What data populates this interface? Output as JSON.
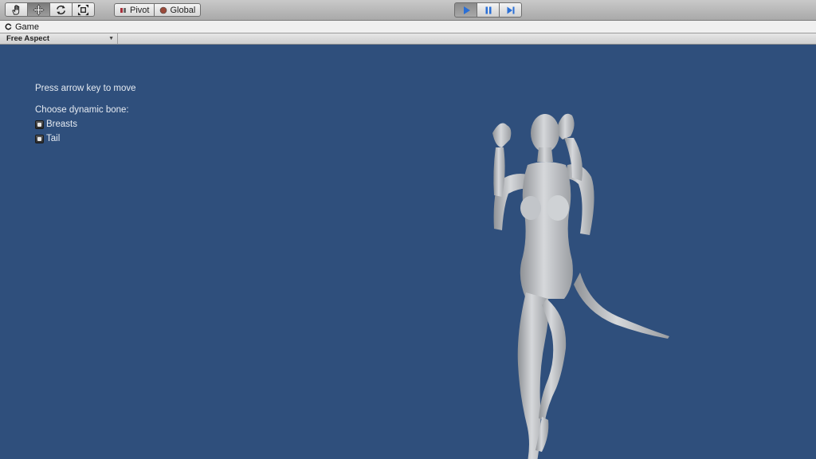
{
  "toolbar": {
    "transform_tools": [
      {
        "name": "hand-icon",
        "active": false
      },
      {
        "name": "move-icon",
        "active": true
      },
      {
        "name": "rotate-icon",
        "active": false
      },
      {
        "name": "scale-icon",
        "active": false
      }
    ],
    "pivot_label": "Pivot",
    "global_label": "Global",
    "playback": [
      {
        "name": "play-icon",
        "active": true
      },
      {
        "name": "pause-icon",
        "active": false
      },
      {
        "name": "step-icon",
        "active": false
      }
    ]
  },
  "tab": {
    "title": "Game",
    "icon": "game-icon"
  },
  "aspect": {
    "selected": "Free Aspect"
  },
  "game": {
    "hint": "Press arrow key to move",
    "choose_label": "Choose dynamic bone:",
    "options": [
      {
        "label": "Breasts",
        "checked": true
      },
      {
        "label": "Tail",
        "checked": true
      }
    ]
  },
  "colors": {
    "background": "#2f4f7c",
    "toolbar": "#b8b8b8",
    "play_accent": "#2a6fd6"
  }
}
